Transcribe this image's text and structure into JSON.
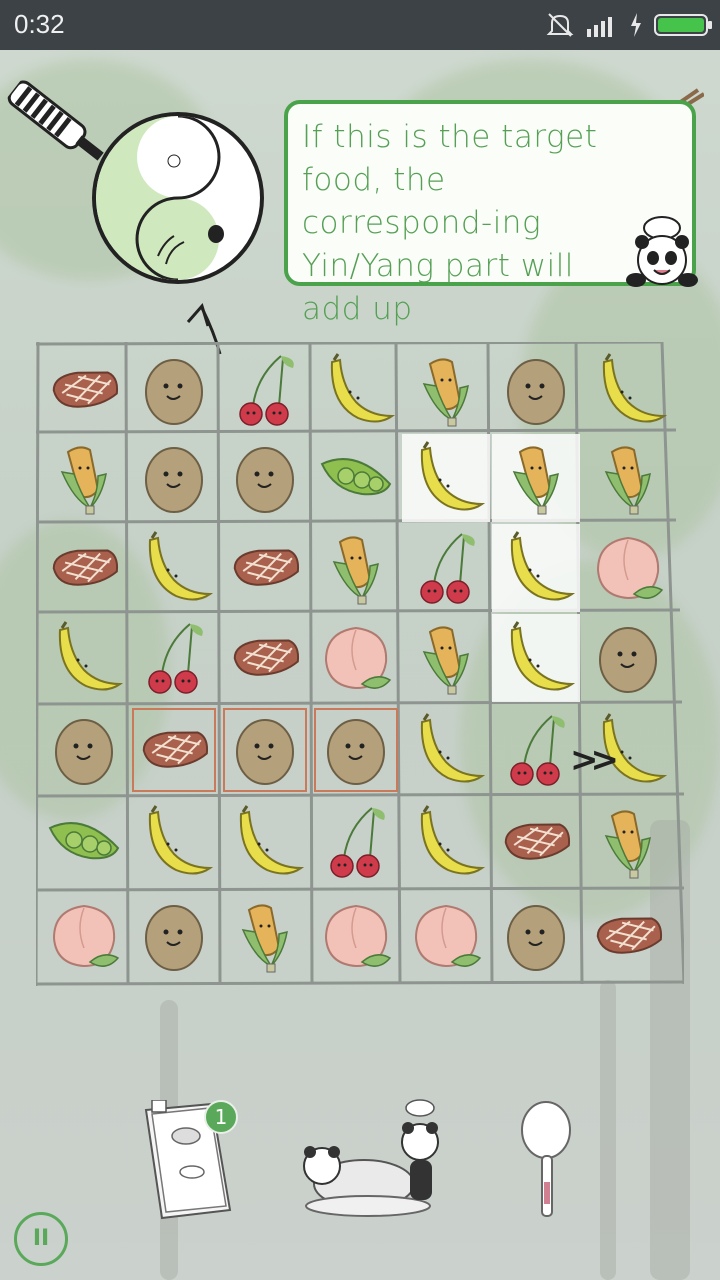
{
  "status_bar": {
    "time": "0:32",
    "icons": [
      "mute-icon",
      "signal-icon",
      "charging-icon",
      "battery-icon"
    ]
  },
  "tooltip": {
    "text": "If this is the target food, the correspond-ing Yin/Yang part will add up"
  },
  "board": {
    "rows": [
      [
        "steak",
        "potato",
        "cherry",
        "banana",
        "corn",
        "potato",
        "banana"
      ],
      [
        "corn",
        "potato",
        "potato",
        "peas",
        "banana",
        "corn",
        "corn"
      ],
      [
        "steak",
        "banana",
        "steak",
        "corn",
        "cherry",
        "banana",
        "peach"
      ],
      [
        "banana",
        "cherry",
        "steak",
        "peach",
        "corn",
        "banana",
        "potato"
      ],
      [
        "potato",
        "steak",
        "potato",
        "potato",
        "banana",
        "cherry",
        "banana"
      ],
      [
        "peas",
        "banana",
        "banana",
        "cherry",
        "banana",
        "steak",
        "corn"
      ],
      [
        "peach",
        "potato",
        "corn",
        "peach",
        "peach",
        "potato",
        "steak"
      ]
    ],
    "highlighted_cells": [
      [
        1,
        4
      ],
      [
        1,
        5
      ],
      [
        2,
        5
      ],
      [
        3,
        5
      ]
    ],
    "selected_cells": [
      [
        4,
        1
      ],
      [
        4,
        2
      ],
      [
        4,
        3
      ]
    ]
  },
  "bottom_bar": {
    "recipe_book_badge": "1",
    "items": [
      "recipe-book-icon",
      "served-dish-icon",
      "spoon-icon"
    ]
  },
  "colors": {
    "accent_green": "#4aa34a",
    "selection_border": "#c97a5a",
    "status_bar_bg": "#3d4246"
  }
}
